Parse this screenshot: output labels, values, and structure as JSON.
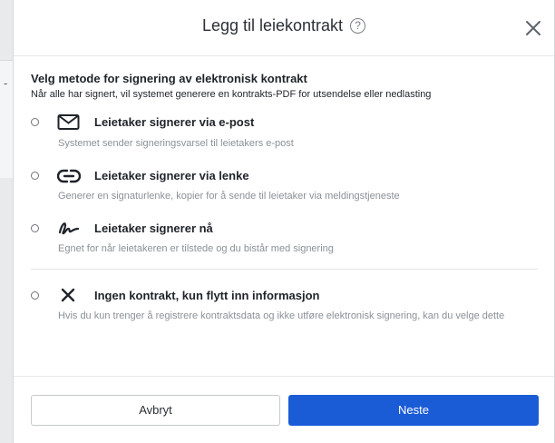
{
  "background": {
    "dash": "-"
  },
  "modal": {
    "title": "Legg til leiekontrakt",
    "help_glyph": "?",
    "section_title": "Velg metode for signering av elektronisk kontrakt",
    "section_subtitle": "Når alle har signert, vil systemet generere en kontrakts-PDF for utsendelse eller nedlasting",
    "options": [
      {
        "icon": "envelope-icon",
        "label": "Leietaker signerer via e-post",
        "description": "Systemet sender signeringsvarsel til leietakers e-post"
      },
      {
        "icon": "link-icon",
        "label": "Leietaker signerer via lenke",
        "description": "Generer en signaturlenke, kopier for å sende til leietaker via meldingstjeneste"
      },
      {
        "icon": "signature-icon",
        "label": "Leietaker signerer nå",
        "description": "Egnet for når leietakeren er tilstede og du bistår med signering"
      },
      {
        "icon": "x-icon",
        "label": "Ingen kontrakt, kun flytt inn informasjon",
        "description": "Hvis du kun trenger å registrere kontraktsdata og ikke utføre elektronisk signering, kan du velge dette"
      }
    ],
    "buttons": {
      "cancel": "Avbryt",
      "next": "Neste"
    },
    "colors": {
      "primary": "#1a5bd6",
      "muted_text": "#8b9097"
    }
  }
}
